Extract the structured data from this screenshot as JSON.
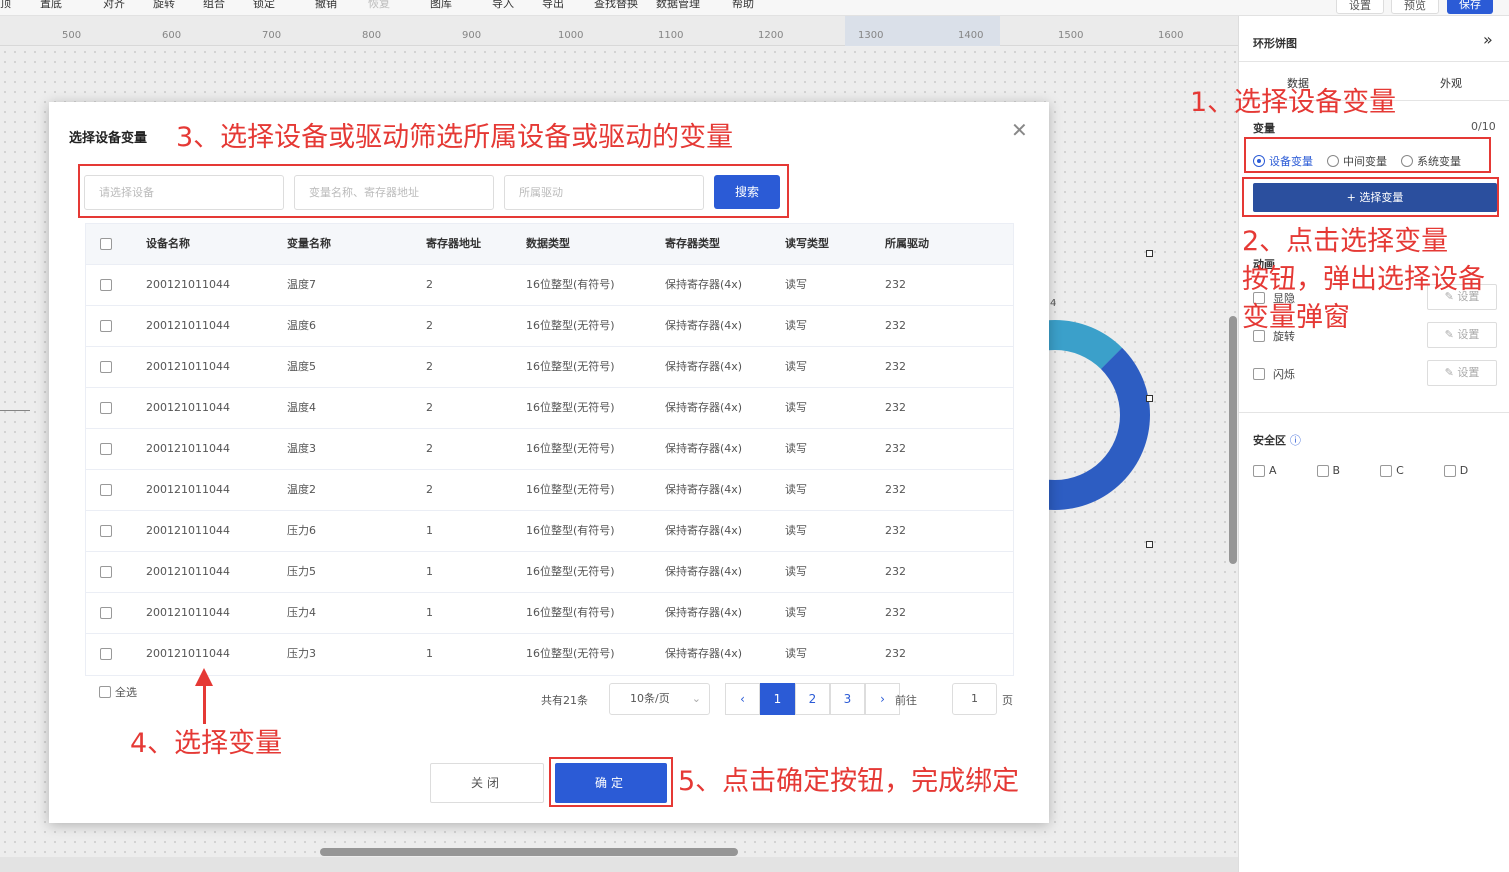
{
  "toolbar": {
    "items": [
      "顶",
      "置底",
      "对齐",
      "旋转",
      "组合",
      "锁定",
      "撤销",
      "恢复",
      "图库",
      "导入",
      "导出",
      "查找替换",
      "数据管理",
      "帮助"
    ],
    "settings_label": "设置",
    "preview_label": "预览",
    "save_label": "保存"
  },
  "ruler": {
    "ticks": [
      "500",
      "600",
      "700",
      "800",
      "900",
      "1000",
      "1100",
      "1200",
      "1300",
      "1400",
      "1500",
      "1600"
    ]
  },
  "canvas": {
    "chart_label": "4"
  },
  "panel": {
    "title": "环形饼图",
    "collapse_glyph": "»",
    "tabs": [
      "数据",
      "外观"
    ],
    "variable_label": "变量",
    "variable_count": "0/10",
    "radios": [
      "设备变量",
      "中间变量",
      "系统变量"
    ],
    "select_variable_button": "+ 选择变量",
    "animation_label": "动画",
    "animations": [
      "显隐",
      "旋转",
      "闪烁"
    ],
    "set_label": "✎ 设置",
    "safe_zone_label": "安全区",
    "safe_zones": [
      "A",
      "B",
      "C",
      "D"
    ]
  },
  "modal": {
    "title": "选择设备变量",
    "device_placeholder": "请选择设备",
    "variable_placeholder": "变量名称、寄存器地址",
    "driver_placeholder": "所属驱动",
    "search_button": "搜索",
    "columns": [
      "设备名称",
      "变量名称",
      "寄存器地址",
      "数据类型",
      "寄存器类型",
      "读写类型",
      "所属驱动"
    ],
    "rows": [
      [
        "200121011044",
        "温度7",
        "2",
        "16位整型(有符号)",
        "保持寄存器(4x)",
        "读写",
        "232"
      ],
      [
        "200121011044",
        "温度6",
        "2",
        "16位整型(无符号)",
        "保持寄存器(4x)",
        "读写",
        "232"
      ],
      [
        "200121011044",
        "温度5",
        "2",
        "16位整型(无符号)",
        "保持寄存器(4x)",
        "读写",
        "232"
      ],
      [
        "200121011044",
        "温度4",
        "2",
        "16位整型(无符号)",
        "保持寄存器(4x)",
        "读写",
        "232"
      ],
      [
        "200121011044",
        "温度3",
        "2",
        "16位整型(无符号)",
        "保持寄存器(4x)",
        "读写",
        "232"
      ],
      [
        "200121011044",
        "温度2",
        "2",
        "16位整型(无符号)",
        "保持寄存器(4x)",
        "读写",
        "232"
      ],
      [
        "200121011044",
        "压力6",
        "1",
        "16位整型(有符号)",
        "保持寄存器(4x)",
        "读写",
        "232"
      ],
      [
        "200121011044",
        "压力5",
        "1",
        "16位整型(无符号)",
        "保持寄存器(4x)",
        "读写",
        "232"
      ],
      [
        "200121011044",
        "压力4",
        "1",
        "16位整型(有符号)",
        "保持寄存器(4x)",
        "读写",
        "232"
      ],
      [
        "200121011044",
        "压力3",
        "1",
        "16位整型(无符号)",
        "保持寄存器(4x)",
        "读写",
        "232"
      ]
    ],
    "select_all_label": "全选",
    "total_label": "共有21条",
    "page_size_label": "10条/页",
    "pages": [
      "1",
      "2",
      "3"
    ],
    "prev_glyph": "‹",
    "next_glyph": "›",
    "goto_label": "前往",
    "goto_value": "1",
    "page_suffix": "页",
    "close_button": "关闭",
    "confirm_button": "确定"
  },
  "annotations": {
    "step1": "1、选择设备变量",
    "step2_line1": "2、点击选择变量",
    "step2_line2": "按钮，弹出选择设备",
    "step2_line3": "变量弹窗",
    "step3": "3、选择设备或驱动筛选所属设备或驱动的变量",
    "step4": "4、选择变量",
    "step5": "5、点击确定按钮，完成绑定"
  },
  "colors": {
    "primary": "#2b5bd6",
    "annotation": "#e53935",
    "ring_dark": "#2e5fc6",
    "ring_light": "#3da4cf"
  }
}
